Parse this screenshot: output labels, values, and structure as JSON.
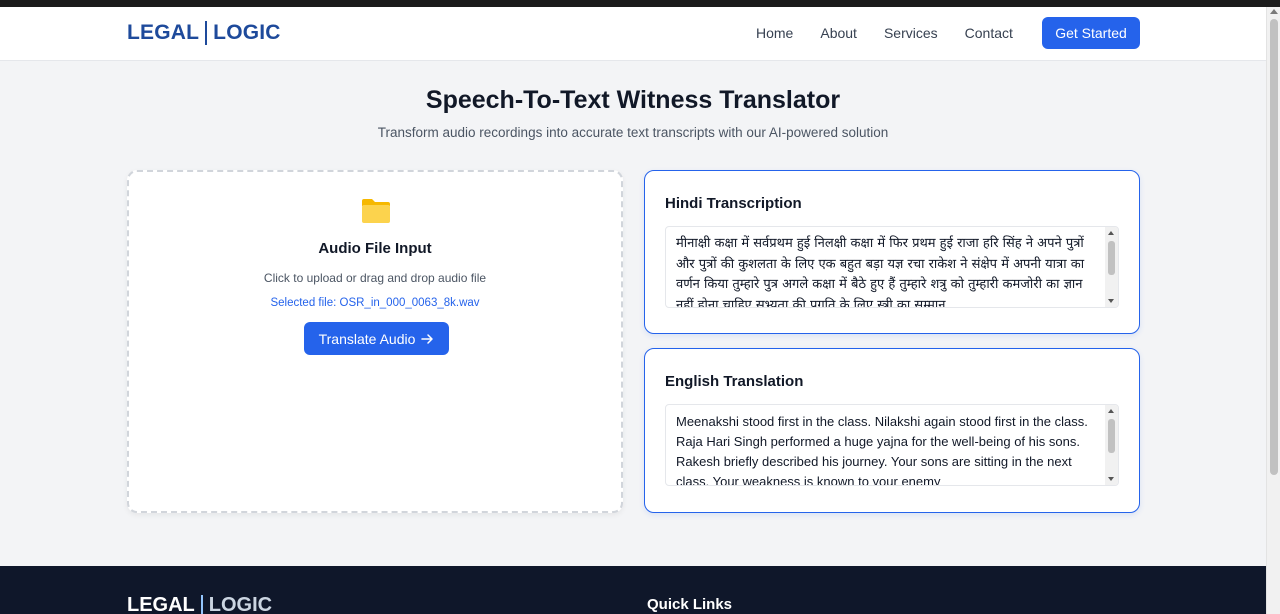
{
  "brand": {
    "part1": "LEGAL",
    "part2": "LOGIC"
  },
  "nav": {
    "links": [
      "Home",
      "About",
      "Services",
      "Contact"
    ],
    "cta": "Get Started"
  },
  "hero": {
    "title": "Speech-To-Text Witness Translator",
    "subtitle": "Transform audio recordings into accurate text transcripts with our AI-powered solution"
  },
  "upload": {
    "icon": "folder-icon",
    "title": "Audio File Input",
    "hint": "Click to upload or drag and drop audio file",
    "selected_file": "Selected file: OSR_in_000_0063_8k.wav",
    "button_label": "Translate Audio",
    "button_icon": "arrow-right-icon"
  },
  "hindi": {
    "title": "Hindi Transcription",
    "text": "मीनाक्षी कक्षा में सर्वप्रथम हुई निलक्षी कक्षा में फिर प्रथम हुई राजा हरि सिंह ने अपने पुत्रों और पुत्रों की कुशलता के लिए एक बहुत बड़ा यज्ञ रचा राकेश ने संक्षेप में अपनी यात्रा का वर्णन किया तुम्हारे पुत्र अगले कक्षा में बैठे हुए हैं तुम्हारे शत्रु को तुम्हारी कमजोरी का ज्ञान नहीं होना चाहिए सभ्यता की प्रगति के लिए स्त्री का सम्मान"
  },
  "english": {
    "title": "English Translation",
    "text": "Meenakshi stood first in the class. Nilakshi again stood first in the class. Raja Hari Singh performed a huge yajna for the well-being of his sons. Rakesh briefly described his journey. Your sons are sitting in the next class. Your weakness is known to your enemy"
  },
  "footer": {
    "brand_part1": "LEGAL",
    "brand_part2": "LOGIC",
    "quick_links_title": "Quick Links"
  },
  "colors": {
    "primary": "#2563eb",
    "brand": "#1e4a9b",
    "footer_bg": "#0f172a",
    "page_bg": "#f3f4f6"
  }
}
